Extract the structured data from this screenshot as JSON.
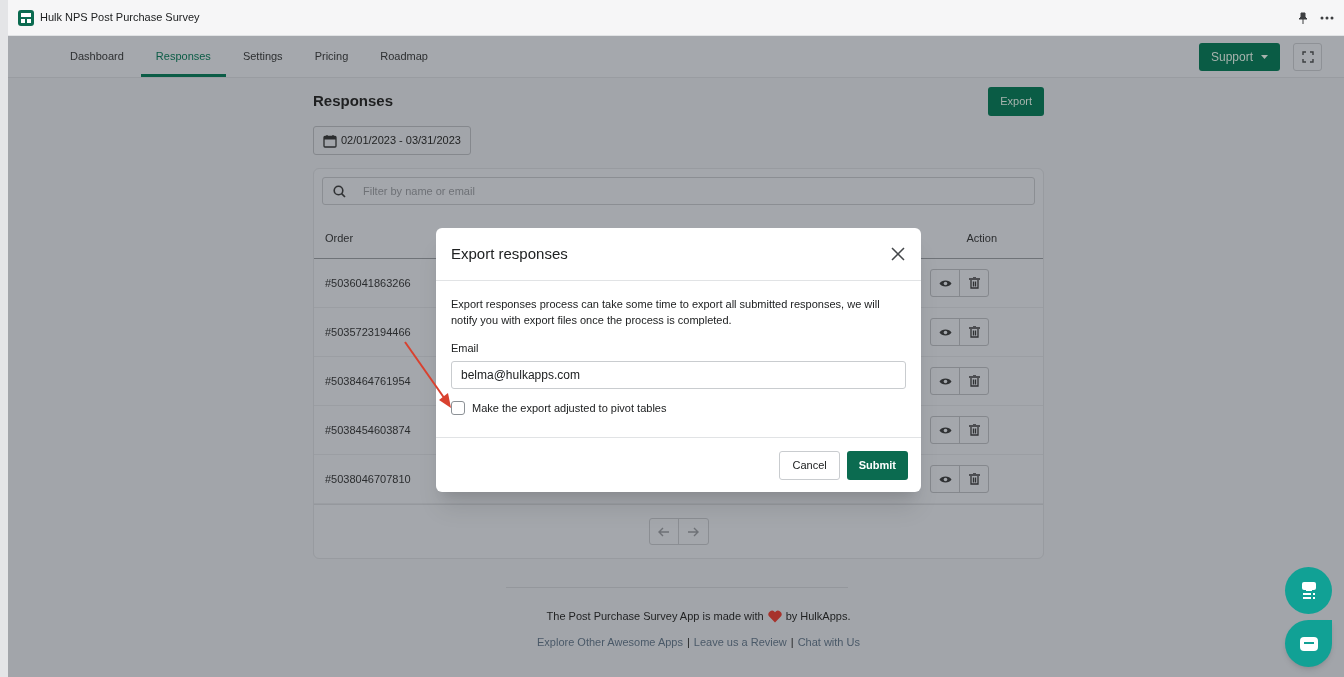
{
  "window": {
    "title": "Hulk NPS Post Purchase Survey"
  },
  "nav": {
    "tabs": [
      {
        "label": "Dashboard",
        "selected": false
      },
      {
        "label": "Responses",
        "selected": true
      },
      {
        "label": "Settings",
        "selected": false
      },
      {
        "label": "Pricing",
        "selected": false
      },
      {
        "label": "Roadmap",
        "selected": false
      }
    ],
    "support_button": "Support"
  },
  "page": {
    "title": "Responses",
    "export_button": "Export",
    "date_range": "02/01/2023 - 03/31/2023"
  },
  "search": {
    "placeholder": "Filter by name or email"
  },
  "table": {
    "columns": [
      "Order",
      "Action"
    ],
    "rows": [
      {
        "order": "#5036041863266"
      },
      {
        "order": "#5035723194466"
      },
      {
        "order": "#5038464761954"
      },
      {
        "order": "#5038454603874"
      },
      {
        "order": "#5038046707810"
      }
    ]
  },
  "footer": {
    "credit": "The Post Purchase Survey App is made with",
    "credit_end": "by HulkApps.",
    "links": [
      "Explore Other Awesome Apps",
      "Leave us a Review",
      "Chat with Us"
    ],
    "separator": "|"
  },
  "modal": {
    "title": "Export responses",
    "message": "Export responses process can take some time to export all submitted responses, we will notify you with export files once the process is completed.",
    "email_label": "Email",
    "email_value": "belma@hulkapps.com",
    "checkbox": {
      "label": "Make the export adjusted to pivot tables",
      "checked": false
    },
    "buttons": [
      {
        "label": "Cancel",
        "kind": "secondary"
      },
      {
        "label": "Submit",
        "kind": "primary"
      }
    ]
  }
}
